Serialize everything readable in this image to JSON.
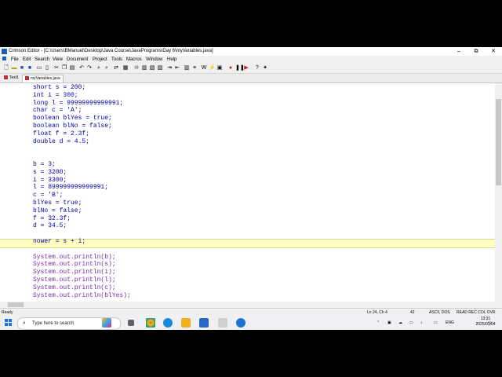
{
  "window": {
    "title": "Crimson Editor - [C:\\Users\\BManuel\\Desktop\\Java Course\\JavaPrograms\\Day 6\\myVariables.java]",
    "controls": {
      "minimize": "–",
      "restore": "⧉",
      "close": "✕"
    }
  },
  "menu": [
    "File",
    "Edit",
    "Search",
    "View",
    "Document",
    "Project",
    "Tools",
    "Macros",
    "Window",
    "Help"
  ],
  "tabs": [
    {
      "label": "Text1",
      "active": false
    },
    {
      "label": "myVariables.java",
      "active": true
    }
  ],
  "code_lines": [
    {
      "text": "short s = 200;",
      "kind": "plain"
    },
    {
      "text": "int i = 300;",
      "kind": "plain"
    },
    {
      "text": "long l = 99999999999991;",
      "kind": "plain"
    },
    {
      "text": "char c = 'A';",
      "kind": "plain"
    },
    {
      "text": "boolean blYes = true;",
      "kind": "plain"
    },
    {
      "text": "boolean blNo = false;",
      "kind": "plain"
    },
    {
      "text": "float f = 2.3f;",
      "kind": "plain"
    },
    {
      "text": "double d = 4.5;",
      "kind": "plain"
    },
    {
      "text": "",
      "kind": "plain"
    },
    {
      "text": "",
      "kind": "plain"
    },
    {
      "text": "b = 3;",
      "kind": "plain"
    },
    {
      "text": "s = 3200;",
      "kind": "plain"
    },
    {
      "text": "i = 3300;",
      "kind": "plain"
    },
    {
      "text": "l = 899999999999991;",
      "kind": "plain"
    },
    {
      "text": "c = 'B';",
      "kind": "plain"
    },
    {
      "text": "blYes = true;",
      "kind": "plain"
    },
    {
      "text": "blNo = false;",
      "kind": "plain"
    },
    {
      "text": "f = 32.3f;",
      "kind": "plain"
    },
    {
      "text": "d = 34.5;",
      "kind": "plain"
    },
    {
      "text": "",
      "kind": "plain"
    },
    {
      "text": "nower = s + i;",
      "kind": "plain"
    },
    {
      "text": "",
      "kind": "plain"
    },
    {
      "text": "System.out.println(b);",
      "kind": "sys"
    },
    {
      "text": "System.out.println(s);",
      "kind": "sys"
    },
    {
      "text": "System.out.println(i);",
      "kind": "sys"
    },
    {
      "text": "System.out.println(l);",
      "kind": "sys"
    },
    {
      "text": "System.out.println(c);",
      "kind": "sys"
    },
    {
      "text": "System.out.println(blYes);",
      "kind": "sys"
    }
  ],
  "status": {
    "ready": "Ready",
    "position": "Ln 24, Ch 4",
    "number": "42",
    "encoding": "ASCII, DOS",
    "flags": "READ  REC  COL  OVR"
  },
  "taskbar": {
    "search_placeholder": "Type here to search",
    "tray_lang": "ENG",
    "time": "13:31",
    "date": "2025/01/04"
  },
  "colors": {
    "keyword": "#0000aa",
    "system_call": "#7a2aa6",
    "current_line": "#ffffc0"
  }
}
